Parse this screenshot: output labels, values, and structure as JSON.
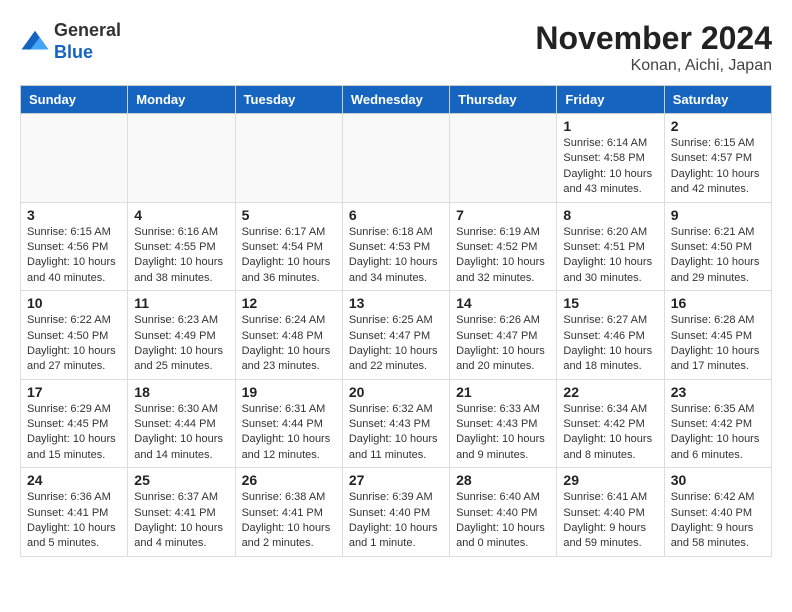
{
  "header": {
    "logo_line1": "General",
    "logo_line2": "Blue",
    "month_title": "November 2024",
    "location": "Konan, Aichi, Japan"
  },
  "weekdays": [
    "Sunday",
    "Monday",
    "Tuesday",
    "Wednesday",
    "Thursday",
    "Friday",
    "Saturday"
  ],
  "weeks": [
    [
      {
        "day": "",
        "info": ""
      },
      {
        "day": "",
        "info": ""
      },
      {
        "day": "",
        "info": ""
      },
      {
        "day": "",
        "info": ""
      },
      {
        "day": "",
        "info": ""
      },
      {
        "day": "1",
        "info": "Sunrise: 6:14 AM\nSunset: 4:58 PM\nDaylight: 10 hours\nand 43 minutes."
      },
      {
        "day": "2",
        "info": "Sunrise: 6:15 AM\nSunset: 4:57 PM\nDaylight: 10 hours\nand 42 minutes."
      }
    ],
    [
      {
        "day": "3",
        "info": "Sunrise: 6:15 AM\nSunset: 4:56 PM\nDaylight: 10 hours\nand 40 minutes."
      },
      {
        "day": "4",
        "info": "Sunrise: 6:16 AM\nSunset: 4:55 PM\nDaylight: 10 hours\nand 38 minutes."
      },
      {
        "day": "5",
        "info": "Sunrise: 6:17 AM\nSunset: 4:54 PM\nDaylight: 10 hours\nand 36 minutes."
      },
      {
        "day": "6",
        "info": "Sunrise: 6:18 AM\nSunset: 4:53 PM\nDaylight: 10 hours\nand 34 minutes."
      },
      {
        "day": "7",
        "info": "Sunrise: 6:19 AM\nSunset: 4:52 PM\nDaylight: 10 hours\nand 32 minutes."
      },
      {
        "day": "8",
        "info": "Sunrise: 6:20 AM\nSunset: 4:51 PM\nDaylight: 10 hours\nand 30 minutes."
      },
      {
        "day": "9",
        "info": "Sunrise: 6:21 AM\nSunset: 4:50 PM\nDaylight: 10 hours\nand 29 minutes."
      }
    ],
    [
      {
        "day": "10",
        "info": "Sunrise: 6:22 AM\nSunset: 4:50 PM\nDaylight: 10 hours\nand 27 minutes."
      },
      {
        "day": "11",
        "info": "Sunrise: 6:23 AM\nSunset: 4:49 PM\nDaylight: 10 hours\nand 25 minutes."
      },
      {
        "day": "12",
        "info": "Sunrise: 6:24 AM\nSunset: 4:48 PM\nDaylight: 10 hours\nand 23 minutes."
      },
      {
        "day": "13",
        "info": "Sunrise: 6:25 AM\nSunset: 4:47 PM\nDaylight: 10 hours\nand 22 minutes."
      },
      {
        "day": "14",
        "info": "Sunrise: 6:26 AM\nSunset: 4:47 PM\nDaylight: 10 hours\nand 20 minutes."
      },
      {
        "day": "15",
        "info": "Sunrise: 6:27 AM\nSunset: 4:46 PM\nDaylight: 10 hours\nand 18 minutes."
      },
      {
        "day": "16",
        "info": "Sunrise: 6:28 AM\nSunset: 4:45 PM\nDaylight: 10 hours\nand 17 minutes."
      }
    ],
    [
      {
        "day": "17",
        "info": "Sunrise: 6:29 AM\nSunset: 4:45 PM\nDaylight: 10 hours\nand 15 minutes."
      },
      {
        "day": "18",
        "info": "Sunrise: 6:30 AM\nSunset: 4:44 PM\nDaylight: 10 hours\nand 14 minutes."
      },
      {
        "day": "19",
        "info": "Sunrise: 6:31 AM\nSunset: 4:44 PM\nDaylight: 10 hours\nand 12 minutes."
      },
      {
        "day": "20",
        "info": "Sunrise: 6:32 AM\nSunset: 4:43 PM\nDaylight: 10 hours\nand 11 minutes."
      },
      {
        "day": "21",
        "info": "Sunrise: 6:33 AM\nSunset: 4:43 PM\nDaylight: 10 hours\nand 9 minutes."
      },
      {
        "day": "22",
        "info": "Sunrise: 6:34 AM\nSunset: 4:42 PM\nDaylight: 10 hours\nand 8 minutes."
      },
      {
        "day": "23",
        "info": "Sunrise: 6:35 AM\nSunset: 4:42 PM\nDaylight: 10 hours\nand 6 minutes."
      }
    ],
    [
      {
        "day": "24",
        "info": "Sunrise: 6:36 AM\nSunset: 4:41 PM\nDaylight: 10 hours\nand 5 minutes."
      },
      {
        "day": "25",
        "info": "Sunrise: 6:37 AM\nSunset: 4:41 PM\nDaylight: 10 hours\nand 4 minutes."
      },
      {
        "day": "26",
        "info": "Sunrise: 6:38 AM\nSunset: 4:41 PM\nDaylight: 10 hours\nand 2 minutes."
      },
      {
        "day": "27",
        "info": "Sunrise: 6:39 AM\nSunset: 4:40 PM\nDaylight: 10 hours\nand 1 minute."
      },
      {
        "day": "28",
        "info": "Sunrise: 6:40 AM\nSunset: 4:40 PM\nDaylight: 10 hours\nand 0 minutes."
      },
      {
        "day": "29",
        "info": "Sunrise: 6:41 AM\nSunset: 4:40 PM\nDaylight: 9 hours\nand 59 minutes."
      },
      {
        "day": "30",
        "info": "Sunrise: 6:42 AM\nSunset: 4:40 PM\nDaylight: 9 hours\nand 58 minutes."
      }
    ]
  ]
}
